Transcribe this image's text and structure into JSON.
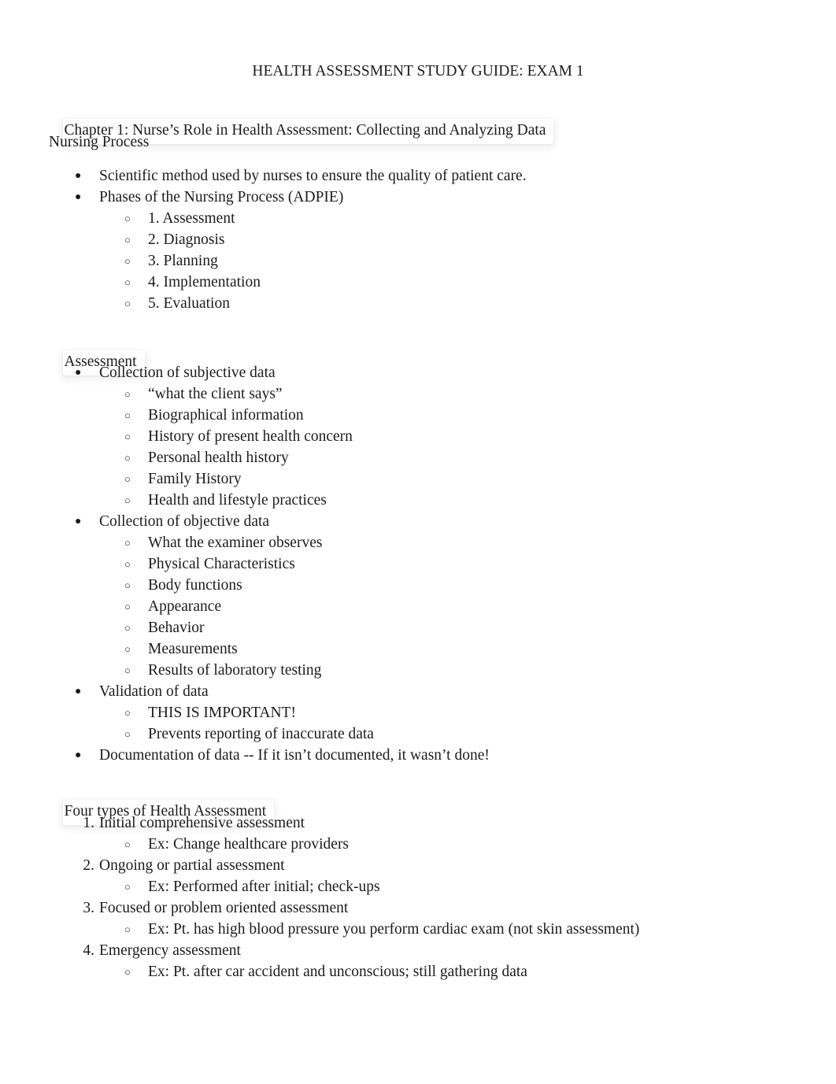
{
  "document": {
    "title": "HEALTH ASSESSMENT STUDY GUIDE: EXAM 1",
    "page_background": "#ffffff",
    "text_color": "#1c1c1c"
  },
  "bullets": {
    "disc": "●",
    "circle": "○"
  },
  "sections": {
    "chapter_heading": "Chapter 1: Nurse’s Role in Health Assessment: Collecting and Analyzing Data",
    "nursing_process_heading": "Nursing Process",
    "assessment_heading": "Assessment",
    "four_types_heading": "Four types of Health Assessment"
  },
  "nursing_process": [
    {
      "text": "Scientific method used by nurses to ensure the quality of patient care.",
      "children": []
    },
    {
      "text": "Phases of the Nursing Process (ADPIE)",
      "children": [
        "1. Assessment",
        "2. Diagnosis",
        "3. Planning",
        "4. Implementation",
        "5. Evaluation"
      ]
    }
  ],
  "assessment": [
    {
      "text": "Collection of subjective data",
      "children": [
        "“what the client says”",
        "Biographical information",
        "History of present health concern",
        "Personal health history",
        "Family History",
        "Health and lifestyle practices"
      ]
    },
    {
      "text": "Collection of objective data",
      "children": [
        "What the examiner observes",
        "Physical Characteristics",
        "Body functions",
        "Appearance",
        "Behavior",
        "Measurements",
        "Results of laboratory testing"
      ]
    },
    {
      "text": "Validation of data",
      "children": [
        "THIS IS IMPORTANT!",
        "Prevents reporting of inaccurate data"
      ]
    },
    {
      "text": "Documentation of data -- If it isn’t documented, it wasn’t done!",
      "children": []
    }
  ],
  "four_types": [
    {
      "number": "1.",
      "text": "Initial comprehensive assessment",
      "children": [
        "Ex: Change healthcare providers"
      ]
    },
    {
      "number": "2.",
      "text": "Ongoing or partial assessment",
      "children": [
        "Ex: Performed after initial; check-ups"
      ]
    },
    {
      "number": "3.",
      "text": "Focused or problem oriented assessment",
      "children": [
        "Ex: Pt. has high blood pressure you perform cardiac exam (not skin assessment)"
      ]
    },
    {
      "number": "4.",
      "text": "Emergency assessment",
      "children": [
        "Ex: Pt. after car accident and unconscious; still gathering data"
      ]
    }
  ]
}
